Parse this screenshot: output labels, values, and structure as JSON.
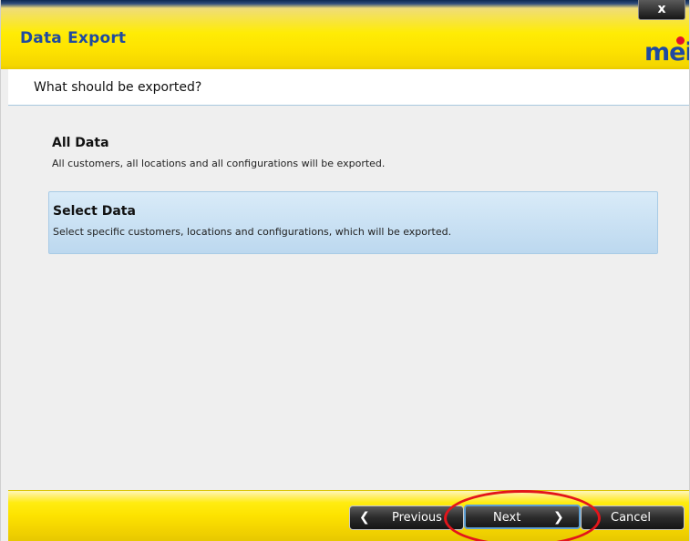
{
  "window": {
    "title": "Data Export",
    "close_label": "x",
    "logo_text": "mei",
    "close_color": "#1a1a1a",
    "accent_yellow": "#ffec05",
    "title_blue": "#1f4aa0"
  },
  "header": {
    "question": "What should be exported?"
  },
  "options": [
    {
      "title": "All Data",
      "description": "All customers, all locations and all configurations will be exported.",
      "selected": false
    },
    {
      "title": "Select Data",
      "description": "Select specific customers, locations and configurations, which will be exported.",
      "selected": true
    }
  ],
  "footer": {
    "previous_label": "Previous",
    "next_label": "Next",
    "cancel_label": "Cancel",
    "prev_icon": "chevron-left-icon",
    "next_icon": "chevron-right-icon",
    "annotation_color": "#e3151b"
  }
}
